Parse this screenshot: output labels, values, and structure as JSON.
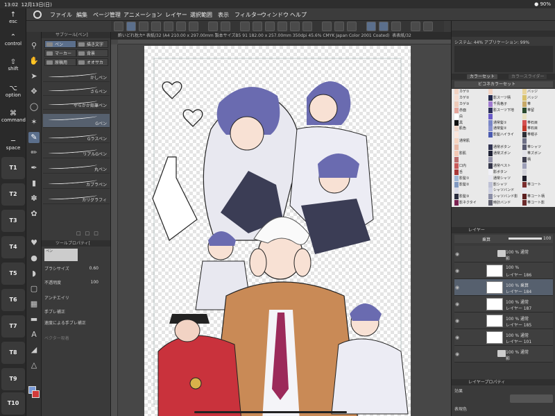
{
  "status": {
    "time": "13:02",
    "date": "12月13日(日)",
    "battery": "90%"
  },
  "menu": [
    "ファイル",
    "編集",
    "ページ管理",
    "アニメーション",
    "レイヤー",
    "選択範囲",
    "表示",
    "フィルター",
    "ウィンドウ",
    "ヘルプ"
  ],
  "keypad": {
    "esc": "esc",
    "control": "control",
    "shift": "shift",
    "option": "option",
    "command": "command",
    "space": "space",
    "tkeys": [
      "T1",
      "T2",
      "T3",
      "T4",
      "T5",
      "T6",
      "T7",
      "T8",
      "T9",
      "T10"
    ]
  },
  "subtool": {
    "title": "サブツール[ペン]",
    "categories": [
      "ペン",
      "描き文字",
      "マーカー",
      "背景",
      "原稿用",
      "オオサカ"
    ],
    "brushes": [
      "かしペン",
      "さらペン",
      "やらかか鉛筆ペン",
      "Gペン",
      "Gラスペン",
      "リアルGペン",
      "丸ペン",
      "カブラペン",
      "カリグラフィ"
    ]
  },
  "toolprop": {
    "title": "ツールプロパティ[",
    "brush_name": "ペン",
    "size_label": "ブラシサイズ",
    "size_value": "0.60",
    "opacity_label": "不透明度",
    "opacity_value": "100",
    "aa_label": "アンチエイリ",
    "stab_label": "手ブレ補正",
    "speed_label": "速度による手ブレ補正",
    "vector_label": "ベクター吸着"
  },
  "document": {
    "tab": "酔いどれ枕カ* 表紙/32 (A4 210.00 x 297.00mm 製本サイズB5 91 182.00 x 257.00mm 350dpi 45.6%  CMYK Japan Color 2001 Coated)",
    "tab2": "表表紙/32"
  },
  "navigator": {
    "line1": "システム: 44%  アプリケーション: 99%"
  },
  "colorset": {
    "title": "カラーセット",
    "tab2": "カラースライダー",
    "set_name": "ビコネカラーセット",
    "rows": [
      {
        "c1": "#f1d2c2",
        "t1": "カゲ①",
        "c2": "#f1d2c2",
        "t2": "",
        "c3": "#e8d49c",
        "t3": "バッジ"
      },
      {
        "c1": "#f7ddd0",
        "t1": "カゲ②",
        "c2": "#22284a",
        "t2": "影スーツ柄",
        "c3": "#d9c26c",
        "t3": "バッジ"
      },
      {
        "c1": "#eecab8",
        "t1": "カゲ③",
        "c2": "#a07ad0",
        "t2": "千鳥格子",
        "c3": "#c8a968",
        "t3": "帯"
      },
      {
        "c1": "#e5a59b",
        "t1": "赤面",
        "c2": "#2b2e5a",
        "t2": "影スーツ下地",
        "c3": "#2a4a2e",
        "t3": "帯留"
      },
      {
        "c1": "#ffffff",
        "t1": "白",
        "c2": "#6a5bc8",
        "t2": "",
        "c3": "#e8e0c0",
        "t3": ""
      },
      {
        "c1": "#111111",
        "t1": "黒",
        "c2": "#7a87c8",
        "t2": "通常髪①",
        "c3": "#d45050",
        "t3": "帯石目"
      },
      {
        "c1": "#f0d6c8",
        "t1": "肌色",
        "c2": "#8891cf",
        "t2": "通常髪②",
        "c3": "#c0392b",
        "t3": "帯石目"
      },
      {
        "c1": "#fbe6dc",
        "t1": "",
        "c2": "#4a5ab0",
        "t2": "影髪ハイライ",
        "c3": "#2c2f36",
        "t3": "帯帽子"
      },
      {
        "c1": "#f7d4bf",
        "t1": "通常肌",
        "c2": "#e6e6ee",
        "t2": "",
        "c3": "#6e7086",
        "t3": ""
      },
      {
        "c1": "#e8b7a4",
        "t1": "",
        "c2": "#313452",
        "t2": "通常ボタン",
        "c3": "#585a70",
        "t3": "帯シャツ"
      },
      {
        "c1": "#f3c8b4",
        "t1": "影肌",
        "c2": "#1f2236",
        "t2": "通常ズボン",
        "c3": "#e1e1e8",
        "t3": "帯ズボン"
      },
      {
        "c1": "#bc6c6c",
        "t1": "",
        "c2": "#8f8fa6",
        "t2": "",
        "c3": "#3e3e4e",
        "t3": "柄"
      },
      {
        "c1": "#c85a5a",
        "t1": "口内",
        "c2": "#34364a",
        "t2": "通常ベスト",
        "c3": "#9ea0b8",
        "t3": ""
      },
      {
        "c1": "#a83838",
        "t1": "舌",
        "c2": "#f0f0f6",
        "t2": "影ボタン",
        "c3": "#d2d2da",
        "t3": ""
      },
      {
        "c1": "#9fb8d8",
        "t1": "影髪①",
        "c2": "#e6e6f0",
        "t2": "通常シャツ",
        "c3": "#1e1e2a",
        "t3": ""
      },
      {
        "c1": "#7f98c0",
        "t1": "影髪②",
        "c2": "#bfc2d6",
        "t2": "影シャツ",
        "c3": "#7a2d2d",
        "t3": "帯コート"
      },
      {
        "c1": "#d9dbe8",
        "t1": "",
        "c2": "#cdd0e2",
        "t2": "シャツバンド",
        "c3": "#e7e7ef",
        "t3": ""
      },
      {
        "c1": "#2a2d3e",
        "t1": "影髪③",
        "c2": "#8b8ea6",
        "t2": "シャツバンド影",
        "c3": "#5b1f1f",
        "t3": "帯コート柄"
      },
      {
        "c1": "#7a2150",
        "t1": "影ネクタイ",
        "c2": "#5e5f6e",
        "t2": "時計バンド",
        "c3": "#6b2a2a",
        "t3": "帯コート影"
      }
    ]
  },
  "layers": {
    "title": "レイヤー",
    "blend": "乗算",
    "opacity": "100",
    "items": [
      {
        "l1": "100 % 通常",
        "l2": "影",
        "folder": true,
        "active": false
      },
      {
        "l1": "100 %",
        "l2": "レイヤー 186",
        "folder": false,
        "active": false
      },
      {
        "l1": "100 % 乗算",
        "l2": "レイヤー 184",
        "folder": false,
        "active": true
      },
      {
        "l1": "100 % 通常",
        "l2": "レイヤー 187",
        "folder": false,
        "active": false
      },
      {
        "l1": "100 % 通常",
        "l2": "レイヤー 185",
        "folder": false,
        "active": false
      },
      {
        "l1": "100 % 通常",
        "l2": "レイヤー 101",
        "folder": false,
        "active": false
      },
      {
        "l1": "100 % 通常",
        "l2": "影",
        "folder": true,
        "active": false
      }
    ]
  },
  "layerprop": {
    "title": "レイヤープロパティ",
    "effect": "効果",
    "expr": "表現色"
  }
}
